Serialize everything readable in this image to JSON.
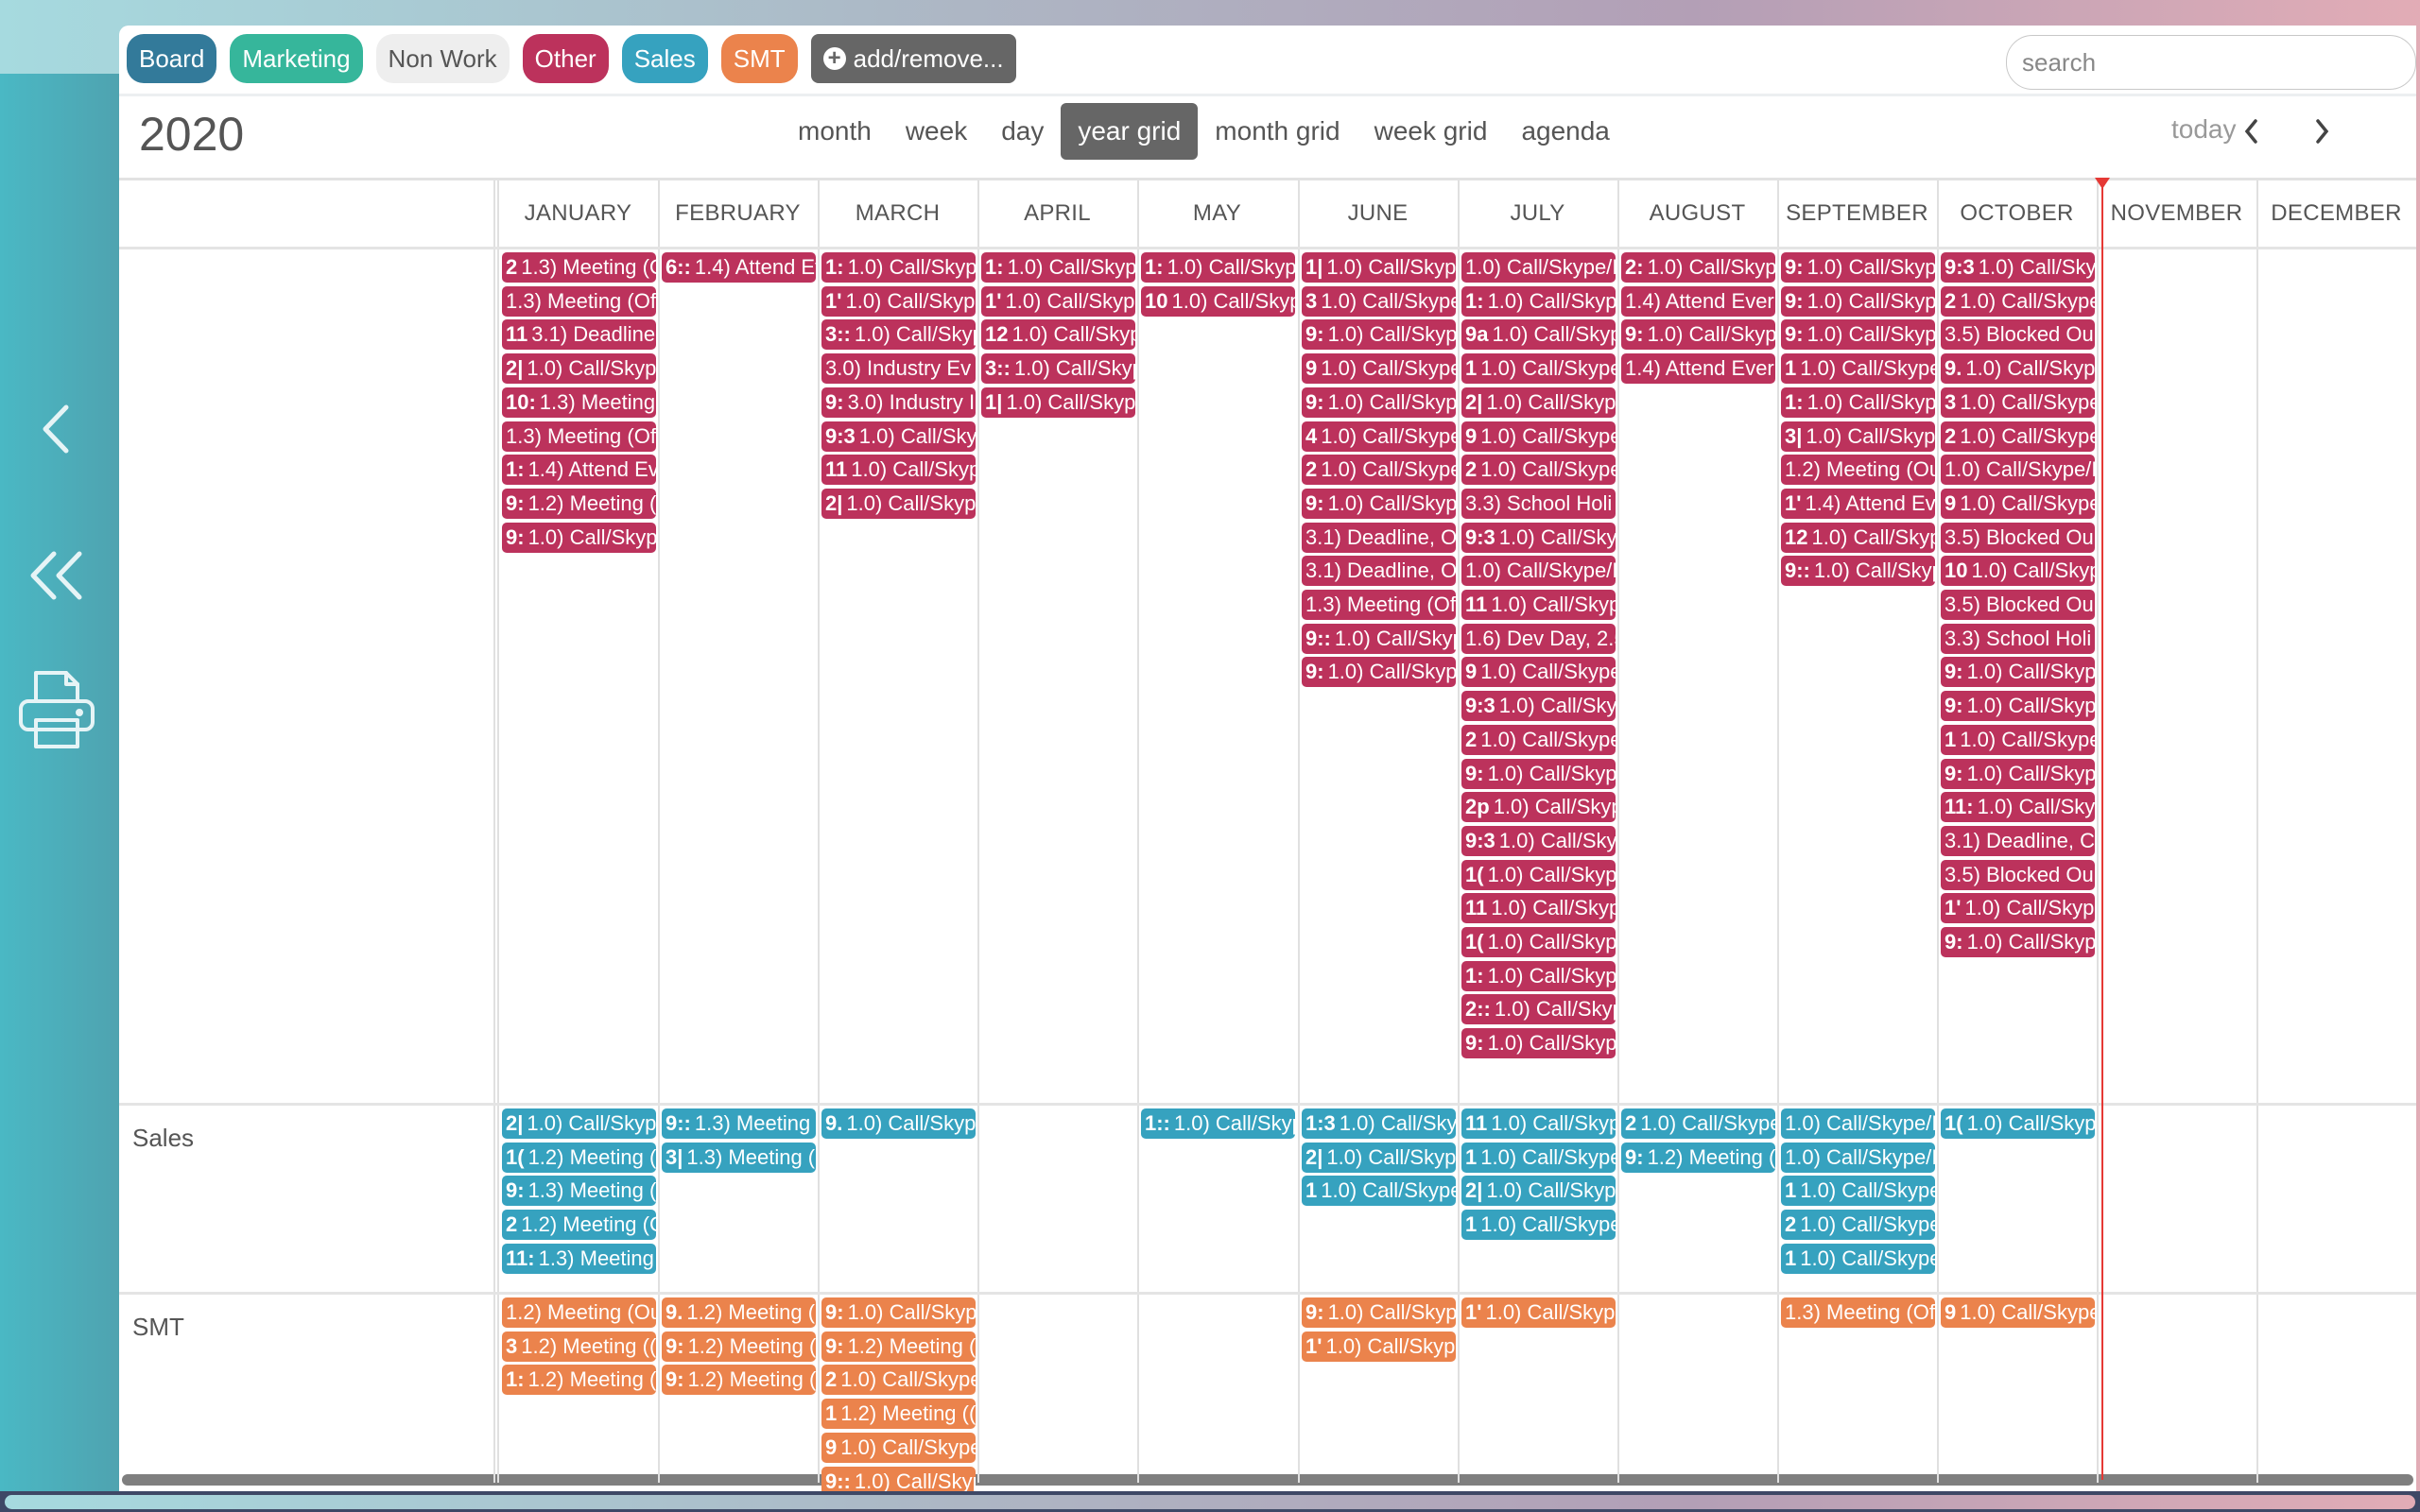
{
  "sidebar": {
    "items": [
      {
        "icon": "chevron-left-icon",
        "label": "Previous"
      },
      {
        "icon": "double-chevron-left-icon",
        "label": "Collapse"
      },
      {
        "icon": "printer-icon",
        "label": "Print"
      }
    ]
  },
  "tags": [
    {
      "label": "Board",
      "color": "#337a9a",
      "text_color": "#ffffff"
    },
    {
      "label": "Marketing",
      "color": "#36b69b",
      "text_color": "#ffffff"
    },
    {
      "label": "Non Work",
      "color": "#eeeeee",
      "text_color": "#555555"
    },
    {
      "label": "Other",
      "color": "#bc325c",
      "text_color": "#ffffff"
    },
    {
      "label": "Sales",
      "color": "#36a2bf",
      "text_color": "#ffffff"
    },
    {
      "label": "SMT",
      "color": "#eb834c",
      "text_color": "#ffffff"
    }
  ],
  "add_remove_label": "add/remove...",
  "search": {
    "placeholder": "search",
    "value": ""
  },
  "header": {
    "title": "2020",
    "views": [
      "month",
      "week",
      "day",
      "year grid",
      "month grid",
      "week grid",
      "agenda"
    ],
    "active_view": "year grid",
    "today_label": "today",
    "prev_icon": "chevron-left-icon",
    "next_icon": "chevron-right-icon"
  },
  "months": [
    "JANUARY",
    "FEBRUARY",
    "MARCH",
    "APRIL",
    "MAY",
    "JUNE",
    "JULY",
    "AUGUST",
    "SEPTEMBER",
    "OCTOBER",
    "NOVEMBER",
    "DECEMBER"
  ],
  "today_month_index": 10,
  "colors": {
    "Other": "#bc325c",
    "Sales": "#36a2bf",
    "SMT": "#eb834c",
    "today_line": "#e53935"
  },
  "rows": [
    {
      "label": "",
      "category": "Other",
      "months": [
        [
          [
            "2",
            "1.3) Meeting (O"
          ],
          [
            "",
            "1.3) Meeting (Of"
          ],
          [
            "11",
            "3.1) Deadline,"
          ],
          [
            "2|",
            "1.0) Call/Skype"
          ],
          [
            "10:",
            "1.3) Meeting"
          ],
          [
            "",
            "1.3) Meeting (Of"
          ],
          [
            "1:",
            "1.4) Attend Ev"
          ],
          [
            "9:",
            "1.2) Meeting ("
          ],
          [
            "9:",
            "1.0) Call/Skyp"
          ]
        ],
        [
          [
            "6::",
            "1.4) Attend Ev"
          ]
        ],
        [
          [
            "1:",
            "1.0) Call/Skyp"
          ],
          [
            "1'",
            "1.0) Call/Skyp"
          ],
          [
            "3::",
            "1.0) Call/Skyp"
          ],
          [
            "",
            "3.0) Industry Ev"
          ],
          [
            "9:",
            "3.0) Industry I"
          ],
          [
            "9:3",
            "1.0) Call/Sky"
          ],
          [
            "11",
            "1.0) Call/Skyp"
          ],
          [
            "2|",
            "1.0) Call/Skyp"
          ]
        ],
        [
          [
            "1:",
            "1.0) Call/Skype"
          ],
          [
            "1'",
            "1.0) Call/Skype"
          ],
          [
            "12",
            "1.0) Call/Skyp"
          ],
          [
            "3::",
            "1.0) Call/Skyp"
          ],
          [
            "1|",
            "1.0) Call/Skype"
          ]
        ],
        [
          [
            "1:",
            "1.0) Call/Skype"
          ],
          [
            "10",
            "1.0) Call/Skyp"
          ]
        ],
        [
          [
            "1|",
            "1.0) Call/Skyp"
          ],
          [
            "3",
            "1.0) Call/Skype"
          ],
          [
            "9:",
            "1.0) Call/Skype"
          ],
          [
            "9",
            "1.0) Call/Skype"
          ],
          [
            "9:",
            "1.0) Call/Skype"
          ],
          [
            "4",
            "1.0) Call/Skype"
          ],
          [
            "2",
            "1.0) Call/Skype"
          ],
          [
            "9:",
            "1.0) Call/Skype"
          ],
          [
            "",
            "3.1) Deadline, O"
          ],
          [
            "",
            "3.1) Deadline, O"
          ],
          [
            "",
            "1.3) Meeting (Of"
          ],
          [
            "9::",
            "1.0) Call/Skyp"
          ],
          [
            "9:",
            "1.0) Call/Skype"
          ]
        ],
        [
          [
            "",
            "1.0) Call/Skype/I"
          ],
          [
            "1:",
            "1.0) Call/Skype"
          ],
          [
            "9a",
            "1.0) Call/Skyp"
          ],
          [
            "1",
            "1.0) Call/Skype"
          ],
          [
            "2|",
            "1.0) Call/Skype"
          ],
          [
            "9",
            "1.0) Call/Skype"
          ],
          [
            "2",
            "1.0) Call/Skype"
          ],
          [
            "",
            "3.3) School Holi"
          ],
          [
            "9:3",
            "1.0) Call/Skyp"
          ],
          [
            "",
            "1.0) Call/Skype/I"
          ],
          [
            "11",
            "1.0) Call/Skyp"
          ],
          [
            "",
            "1.6) Dev Day, 2.5"
          ],
          [
            "9",
            "1.0) Call/Skype"
          ],
          [
            "9:3",
            "1.0) Call/Skyp"
          ],
          [
            "2",
            "1.0) Call/Skype"
          ],
          [
            "9:",
            "1.0) Call/Skype"
          ],
          [
            "2p",
            "1.0) Call/Skyp"
          ],
          [
            "9:3",
            "1.0) Call/Skyp"
          ],
          [
            "1(",
            "1.0) Call/Skype"
          ],
          [
            "11",
            "1.0) Call/Skyp"
          ],
          [
            "1(",
            "1.0) Call/Skype"
          ],
          [
            "1:",
            "1.0) Call/Skype"
          ],
          [
            "2::",
            "1.0) Call/Skyp"
          ],
          [
            "9:",
            "1.0) Call/Skyp"
          ]
        ],
        [
          [
            "2:",
            "1.0) Call/Skype"
          ],
          [
            "",
            "1.4) Attend Ever"
          ],
          [
            "9:",
            "1.0) Call/Skype"
          ],
          [
            "",
            "1.4) Attend Ever"
          ]
        ],
        [
          [
            "9:",
            "1.0) Call/Skype"
          ],
          [
            "9:",
            "1.0) Call/Skyp"
          ],
          [
            "9:",
            "1.0) Call/Skype"
          ],
          [
            "1",
            "1.0) Call/Skype"
          ],
          [
            "1:",
            "1.0) Call/Skype"
          ],
          [
            "3|",
            "1.0) Call/Skype"
          ],
          [
            "",
            "1.2) Meeting (Ou"
          ],
          [
            "1'",
            "1.4) Attend Ev"
          ],
          [
            "12",
            "1.0) Call/Skyp"
          ],
          [
            "9::",
            "1.0) Call/Skyp"
          ]
        ],
        [
          [
            "9:3",
            "1.0) Call/Sky"
          ],
          [
            "2",
            "1.0) Call/Skype"
          ],
          [
            "",
            "3.5) Blocked Ou"
          ],
          [
            "9.",
            "1.0) Call/Skype"
          ],
          [
            "3",
            "1.0) Call/Skype"
          ],
          [
            "2",
            "1.0) Call/Skype"
          ],
          [
            "",
            "1.0) Call/Skype/I"
          ],
          [
            "9",
            "1.0) Call/Skype"
          ],
          [
            "",
            "3.5) Blocked Ou"
          ],
          [
            "10",
            "1.0) Call/Skyp"
          ],
          [
            "",
            "3.5) Blocked Ou"
          ],
          [
            "",
            "3.3) School Holi"
          ],
          [
            "9:",
            "1.0) Call/Skyp"
          ],
          [
            "9:",
            "1.0) Call/Skyp"
          ],
          [
            "1",
            "1.0) Call/Skype"
          ],
          [
            "9:",
            "1.0) Call/Skyp"
          ],
          [
            "11:",
            "1.0) Call/Sky"
          ],
          [
            "",
            "3.1) Deadline, C"
          ],
          [
            "",
            "3.5) Blocked Ou"
          ],
          [
            "1'",
            "1.0) Call/Skype"
          ],
          [
            "9:",
            "1.0) Call/Skyp"
          ]
        ],
        [],
        []
      ]
    },
    {
      "label": "Sales",
      "category": "Sales",
      "months": [
        [
          [
            "2|",
            "1.0) Call/Skype"
          ],
          [
            "1(",
            "1.2) Meeting ("
          ],
          [
            "9:",
            "1.3) Meeting ("
          ],
          [
            "2",
            "1.2) Meeting (C"
          ],
          [
            "11:",
            "1.3) Meeting"
          ]
        ],
        [
          [
            "9::",
            "1.3) Meeting"
          ],
          [
            "3|",
            "1.3) Meeting ("
          ]
        ],
        [
          [
            "9.",
            "1.0) Call/Skype"
          ]
        ],
        [],
        [
          [
            "1::",
            "1.0) Call/Skyp"
          ]
        ],
        [
          [
            "1:3",
            "1.0) Call/Skyp"
          ],
          [
            "2|",
            "1.0) Call/Skyp"
          ],
          [
            "1",
            "1.0) Call/Skype"
          ]
        ],
        [
          [
            "11",
            "1.0) Call/Skyp"
          ],
          [
            "1",
            "1.0) Call/Skype"
          ],
          [
            "2|",
            "1.0) Call/Skyp"
          ],
          [
            "1",
            "1.0) Call/Skype"
          ]
        ],
        [
          [
            "2",
            "1.0) Call/Skype"
          ],
          [
            "9:",
            "1.2) Meeting ("
          ]
        ],
        [
          [
            "",
            "1.0) Call/Skype/I"
          ],
          [
            "",
            "1.0) Call/Skype/I"
          ],
          [
            "1",
            "1.0) Call/Skype"
          ],
          [
            "2",
            "1.0) Call/Skype"
          ],
          [
            "1",
            "1.0) Call/Skype"
          ]
        ],
        [
          [
            "1(",
            "1.0) Call/Skyp"
          ]
        ],
        [],
        []
      ]
    },
    {
      "label": "SMT",
      "category": "SMT",
      "months": [
        [
          [
            "",
            "1.2) Meeting (Ou"
          ],
          [
            "3",
            "1.2) Meeting (("
          ],
          [
            "1:",
            "1.2) Meeting ("
          ]
        ],
        [
          [
            "9.",
            "1.2) Meeting ("
          ],
          [
            "9:",
            "1.2) Meeting ("
          ],
          [
            "9:",
            "1.2) Meeting ("
          ]
        ],
        [
          [
            "9:",
            "1.0) Call/Skyp"
          ],
          [
            "9:",
            "1.2) Meeting ("
          ],
          [
            "2",
            "1.0) Call/Skype"
          ],
          [
            "1",
            "1.2) Meeting (("
          ],
          [
            "9",
            "1.0) Call/Skype"
          ],
          [
            "9::",
            "1.0) Call/Skyp"
          ]
        ],
        [],
        [],
        [
          [
            "9:",
            "1.0) Call/Skyp"
          ],
          [
            "1'",
            "1.0) Call/Skype"
          ]
        ],
        [
          [
            "1'",
            "1.0) Call/Skype"
          ]
        ],
        [],
        [
          [
            "",
            "1.3) Meeting (Of"
          ]
        ],
        [
          [
            "9",
            "1.0) Call/Skype"
          ]
        ],
        [],
        []
      ]
    }
  ]
}
